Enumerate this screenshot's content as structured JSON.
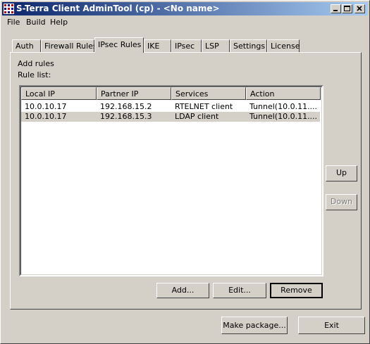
{
  "window": {
    "title": "S-Terra Client AdminTool (cp) - <No name>",
    "icon": "s-terra-app-icon",
    "controls": [
      "minimize-icon",
      "maximize-icon",
      "close-icon"
    ]
  },
  "menu": {
    "items": [
      "File",
      "Build",
      "Help"
    ]
  },
  "tabs": [
    {
      "label": "Auth"
    },
    {
      "label": "Firewall Rules"
    },
    {
      "label": "IPsec Rules",
      "active": true
    },
    {
      "label": "IKE"
    },
    {
      "label": "IPsec"
    },
    {
      "label": "LSP"
    },
    {
      "label": "Settings"
    },
    {
      "label": "License"
    }
  ],
  "panel": {
    "heading": "Add rules",
    "list_label": "Rule list:",
    "columns": [
      "Local IP",
      "Partner IP",
      "Services",
      "Action"
    ],
    "rows": [
      {
        "local_ip": "10.0.10.17",
        "partner_ip": "192.168.15.2",
        "services": "RTELNET client",
        "action": "Tunnel(10.0.11....",
        "selected": false
      },
      {
        "local_ip": "10.0.10.17",
        "partner_ip": "192.168.15.3",
        "services": "LDAP client",
        "action": "Tunnel(10.0.11....",
        "selected": true
      }
    ],
    "buttons": {
      "add": "Add...",
      "edit": "Edit...",
      "remove": "Remove",
      "up": "Up",
      "down": "Down"
    }
  },
  "footer": {
    "make_package": "Make package...",
    "exit": "Exit"
  },
  "colors": {
    "titlebar_start": "#0a246a",
    "titlebar_end": "#a6caf0",
    "face": "#d4d0c8"
  }
}
